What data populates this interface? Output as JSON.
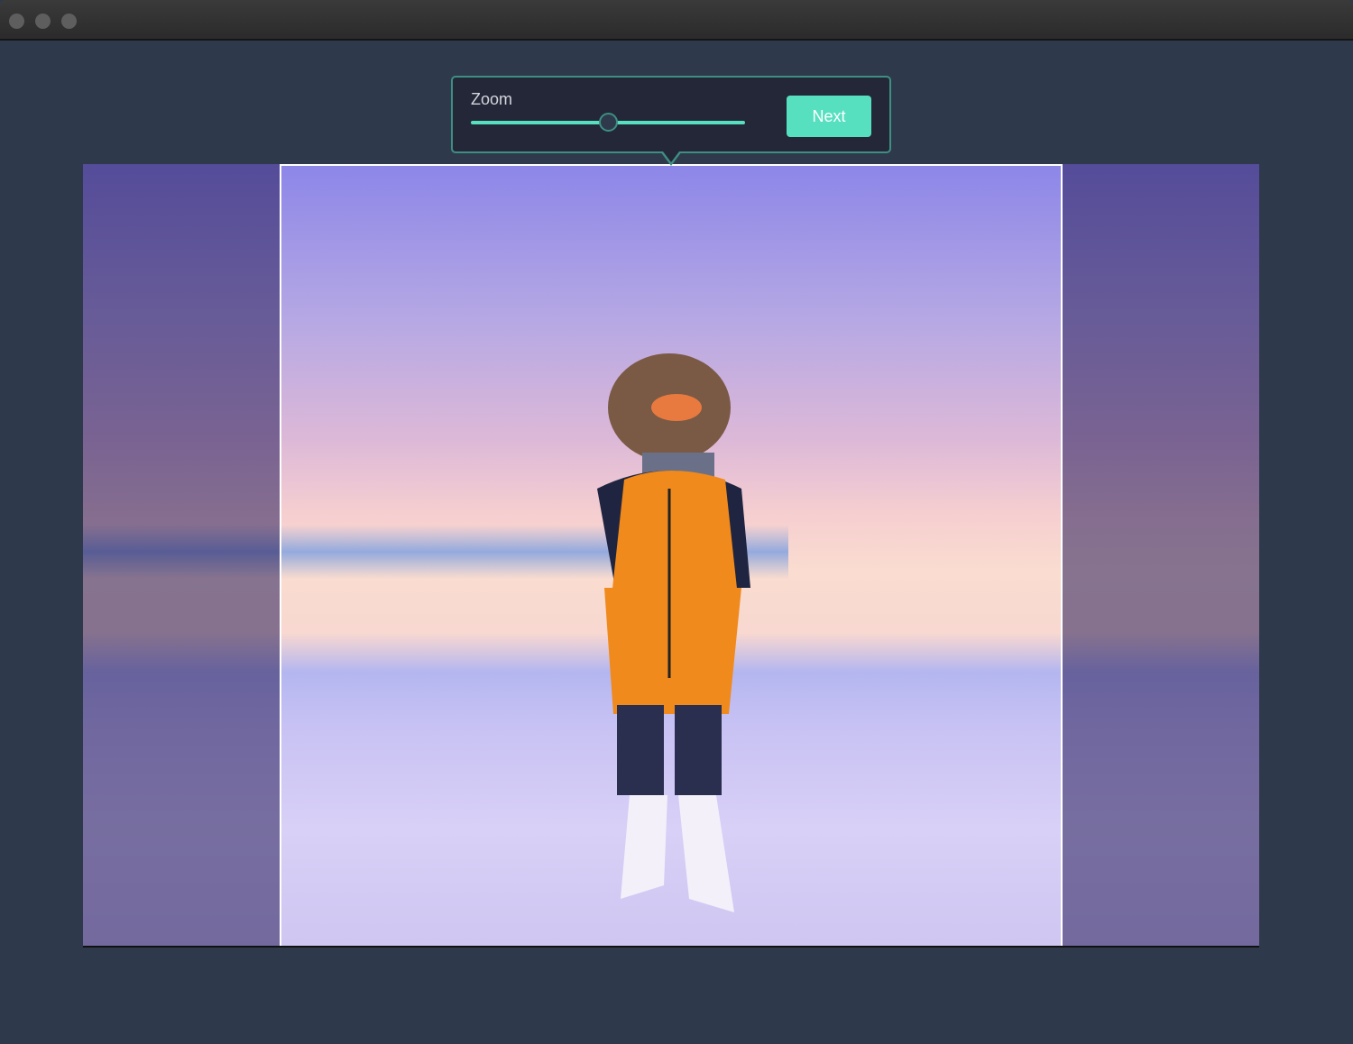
{
  "window": {
    "controls": [
      "close",
      "minimize",
      "maximize"
    ]
  },
  "zoom_popover": {
    "label": "Zoom",
    "slider_value_percent": 50,
    "next_label": "Next"
  },
  "colors": {
    "accent": "#57e0c0",
    "popover_bg": "#232738",
    "page_bg": "#2e3a4c"
  }
}
